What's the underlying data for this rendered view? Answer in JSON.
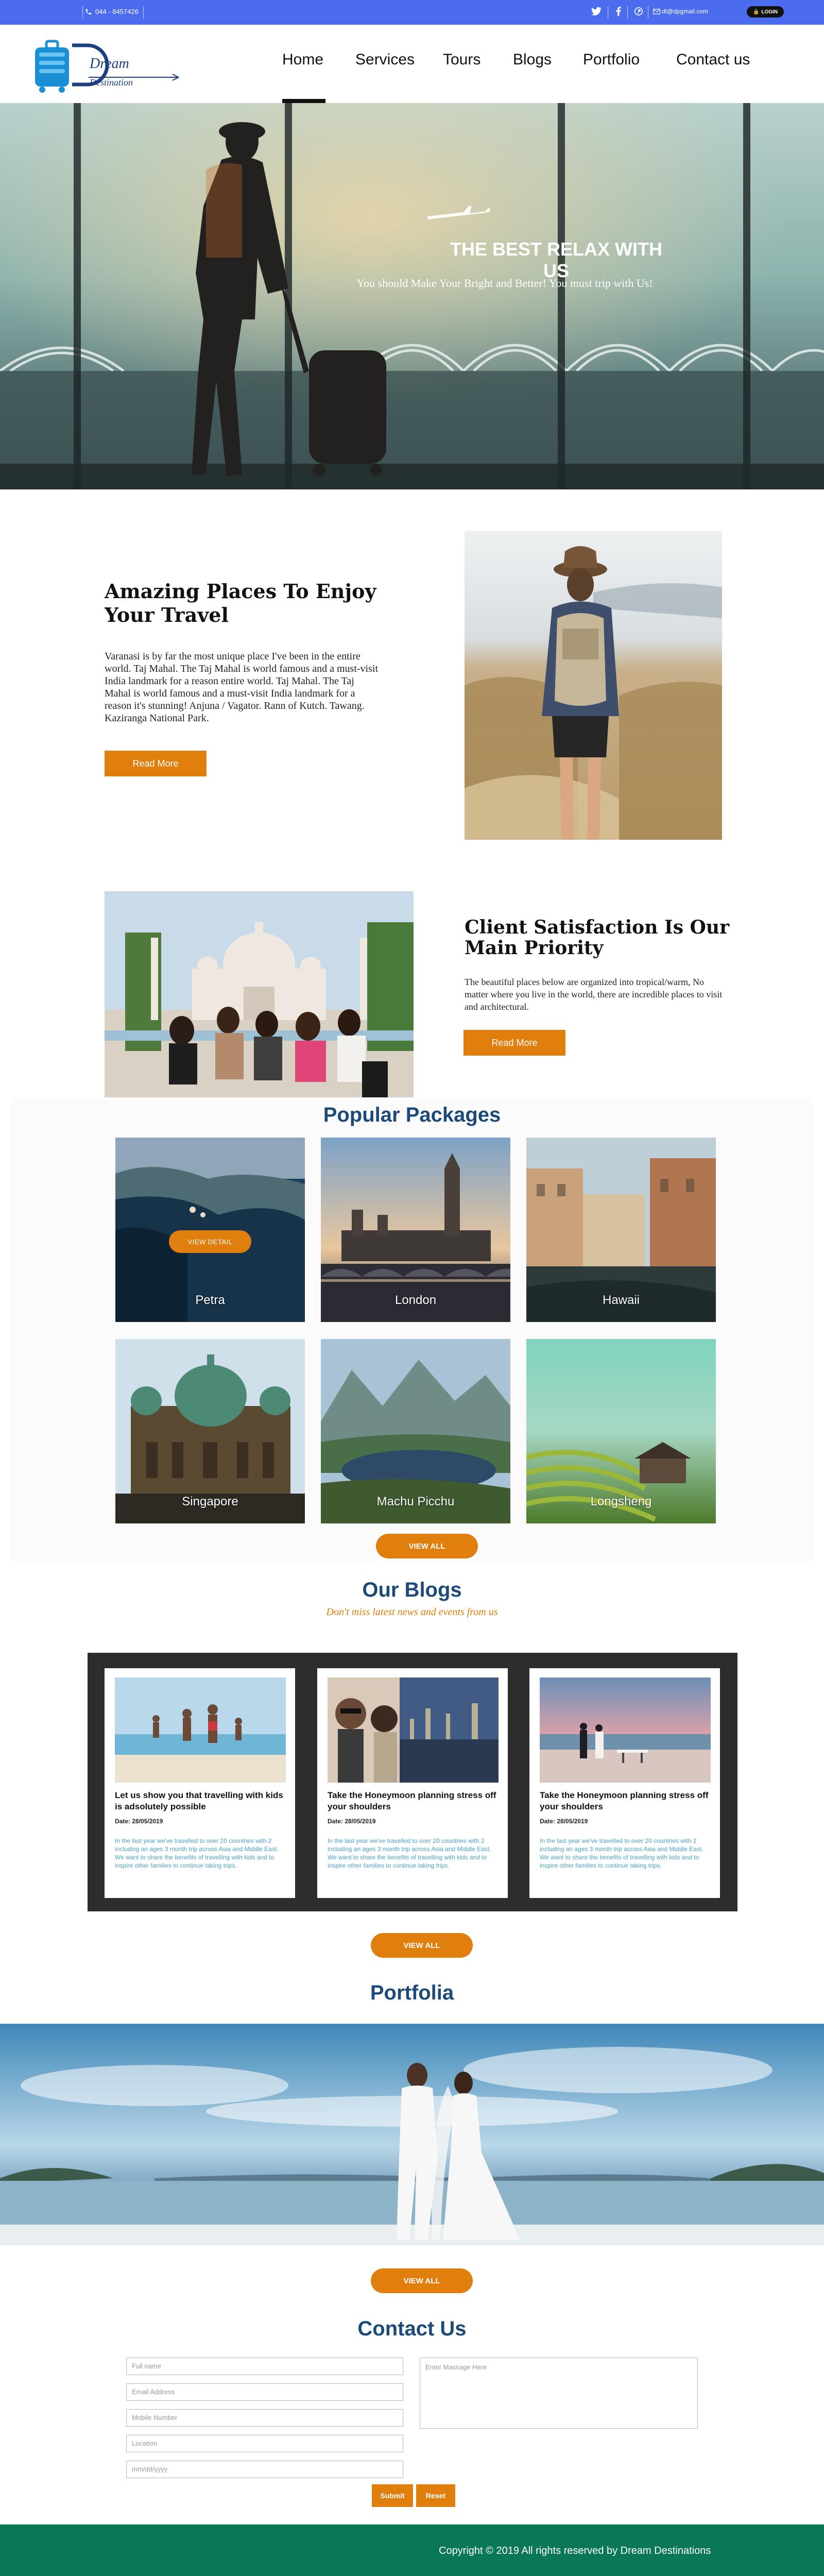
{
  "topbar": {
    "phone": "044 - 8457426",
    "email": "dt@dpgmail.com",
    "login_label": "LOGIN"
  },
  "brand": {
    "logo_text_1": "Dream",
    "logo_text_2": "Destination"
  },
  "nav": {
    "items": [
      "Home",
      "Services",
      "Tours",
      "Blogs",
      "Portfolio",
      "Contact us"
    ],
    "active": "Home"
  },
  "hero": {
    "title": "THE BEST RELAX WITH US",
    "subtitle": "You should Make Your Bright and Better! You must trip with Us!"
  },
  "amazing": {
    "title": "Amazing Places To Enjoy Your Travel",
    "text": "Varanasi is by far the most unique place I've been in the entire world. Taj Mahal. The Taj Mahal is world famous and a must-visit India landmark for a reason entire world. Taj Mahal. The Taj Mahal is world famous and a must-visit India landmark for a reason it's stunning! Anjuna / Vagator. Rann of Kutch. Tawang. Kaziranga National Park.",
    "button": "Read More"
  },
  "client": {
    "title": "Client Satisfaction Is Our Main Priority",
    "text": "The beautiful places below are organized into tropical/warm, No matter where you live in the world, there are incredible places to visit and architectural.",
    "button": "Read More"
  },
  "packages": {
    "heading": "Popular Packages",
    "detail_label": "VIEW DETAIL",
    "view_all": "VIEW ALL",
    "items": [
      "Petra",
      "London",
      "Hawaii",
      "Singapore",
      "Machu Picchu",
      "Longsheng"
    ]
  },
  "blogs": {
    "heading": "Our Blogs",
    "subheading": "Don't miss latest news and events from us",
    "view_all": "VIEW ALL",
    "items": [
      {
        "title": "Let us show you that travelling with kids is adsolutely possible",
        "date": "Date: 28/05/2019",
        "text": "In the last year we've travelled to over 20 countries with 2 including an ages 3 month trip across Asia and Middle East. We want to share the benefits of travelling with kids and to inspire other families to continue taking trips."
      },
      {
        "title": "Take the Honeymoon planning stress off your shoulders",
        "date": "Date: 28/05/2019",
        "text": "In the last year we've travelled to over 20 countries with 2 including an ages 3 month trip across Asia and Middle East. We want to share the benefits of travelling with kids and to inspire other families to continue taking trips."
      },
      {
        "title": "Take the Honeymoon planning stress off your shoulders",
        "date": "Date: 28/05/2019",
        "text": "In the last year we've travelled to over 20 countries with 2 including an ages 3 month trip across Asia and Middle East. We want to share the benefits of travelling with kids and to inspire other families to continue taking trips."
      }
    ]
  },
  "portfolio": {
    "heading": "Portfolia",
    "view_all": "VIEW ALL"
  },
  "contact": {
    "heading": "Contact Us",
    "fields": [
      "Full name",
      "Email Address",
      "Mobile Number",
      "Location",
      "mm/dd/yyyy"
    ],
    "message_placeholder": "Enter Massage Here",
    "submit": "Submit",
    "reset": "Reset"
  },
  "footer": {
    "copyright": "Copyright © 2019 All rights reserved by Dream Destinations"
  },
  "colors": {
    "topbar": "#4c6cf0",
    "accent": "#e07e0e",
    "heading": "#1c4a79",
    "footer": "#0a7758"
  }
}
